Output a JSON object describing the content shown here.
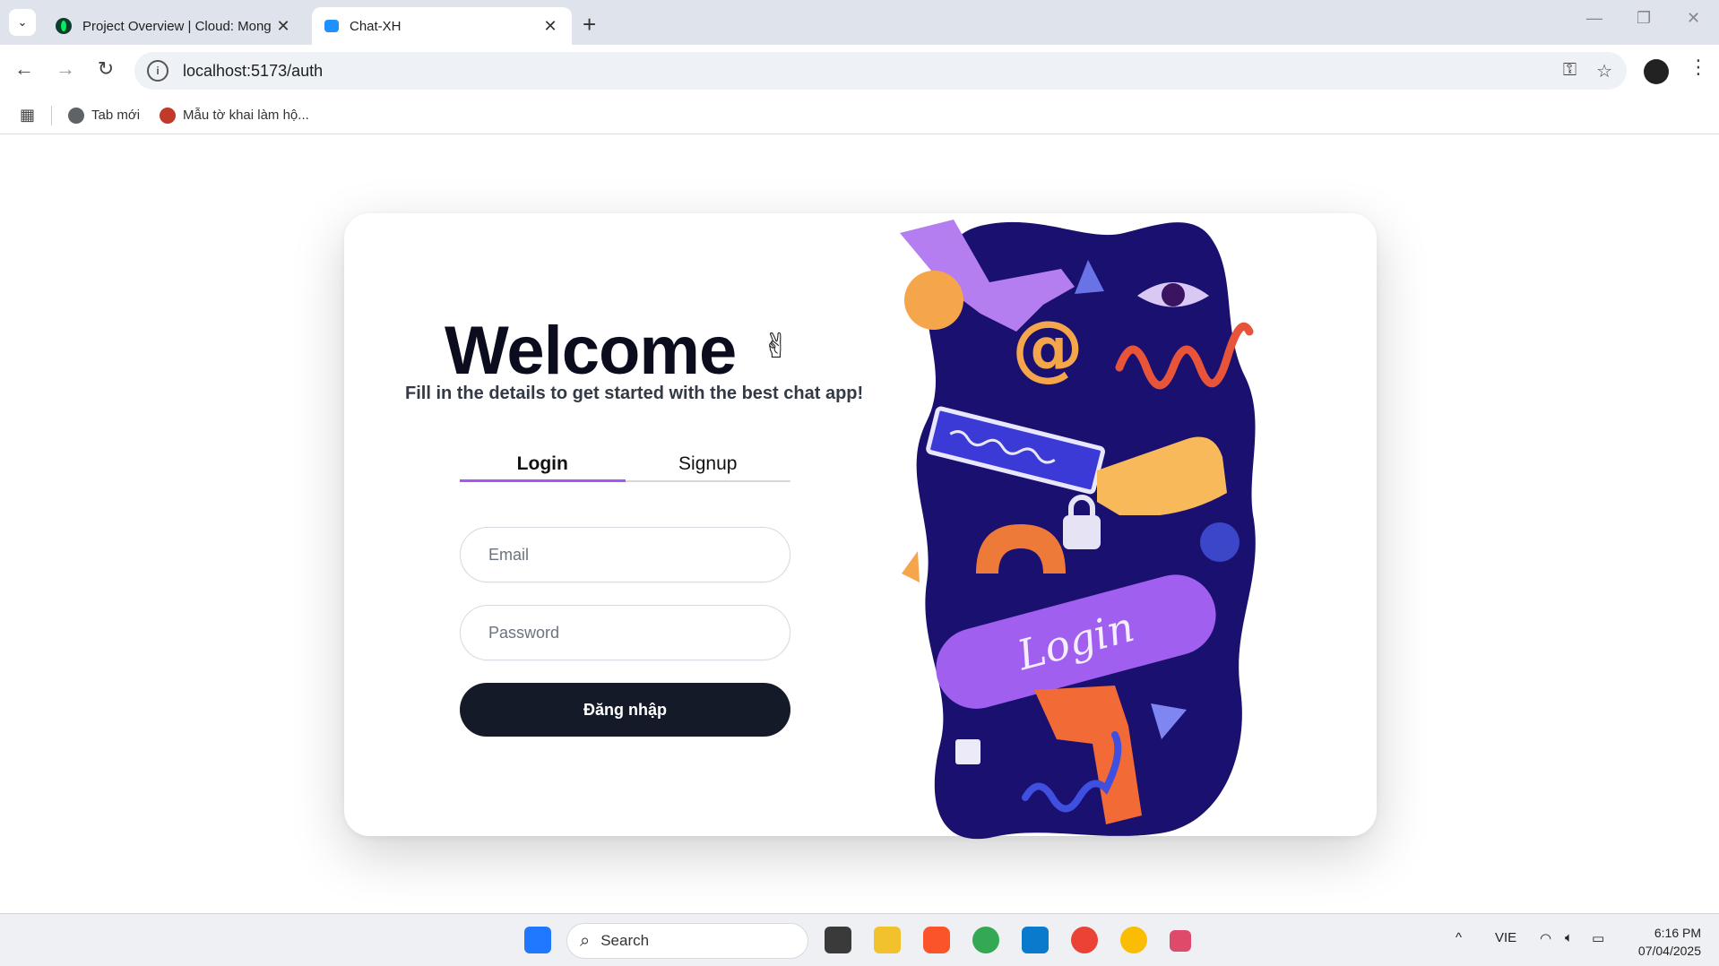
{
  "browser": {
    "tabs": [
      {
        "title": "Project Overview | Cloud: Mong",
        "close": "✕"
      },
      {
        "title": "Chat-XH",
        "close": "✕"
      }
    ],
    "new_tab": "+",
    "window_controls": {
      "minimize": "—",
      "restore": "❐",
      "close": "✕"
    },
    "nav": {
      "back": "←",
      "forward": "→",
      "reload": "↻"
    },
    "url": "localhost:5173/auth",
    "omnibox_icons": {
      "password": "⚿",
      "bookmark": "☆"
    },
    "menu": "⋮",
    "bookmarks": [
      {
        "label": "Tab mới",
        "icon": "globe-icon"
      },
      {
        "label": "Mẫu tờ khai làm hộ...",
        "icon": "site-icon"
      }
    ],
    "apps_icon": "▦"
  },
  "auth": {
    "heading": "Welcome",
    "wave_emoji": "✌",
    "subtitle": "Fill in the details to get started with the best chat app!",
    "tabs": [
      {
        "label": "Login",
        "active": true
      },
      {
        "label": "Signup",
        "active": false
      }
    ],
    "email_placeholder": "Email",
    "email_value": "",
    "password_placeholder": "Password",
    "password_value": "",
    "submit_label": "Đăng nhập",
    "illustration_text": "Login",
    "colors": {
      "accent": "#a855f7",
      "button": "#141a28",
      "illustration_bg": "#1a1070"
    }
  },
  "taskbar": {
    "search_label": "Search",
    "language": "VIE",
    "time": "6:16 PM",
    "date": "07/04/2025",
    "tray_chevron": "^"
  }
}
